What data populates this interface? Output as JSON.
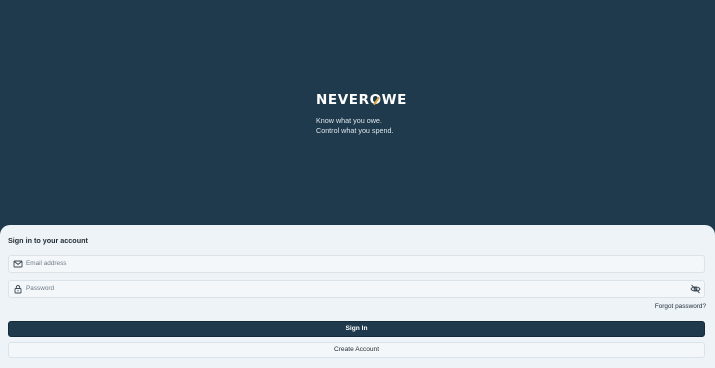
{
  "brand": {
    "logo_before": "NEVER",
    "logo_o": "O",
    "logo_after": "WE",
    "tagline_1": "Know what you owe.",
    "tagline_2": "Control what you spend."
  },
  "signin": {
    "title": "Sign in to your account",
    "email_placeholder": "Email address",
    "password_placeholder": "Password",
    "forgot_label": "Forgot password?",
    "signin_label": "Sign In",
    "create_label": "Create Account"
  },
  "icons": {
    "email": "mail-icon",
    "password": "lock-icon",
    "toggle_visibility": "eye-off-icon"
  },
  "colors": {
    "background": "#1f3a4c",
    "card": "#eef3f7",
    "accent": "#d9a441",
    "primary_button": "#1f3a4c"
  }
}
